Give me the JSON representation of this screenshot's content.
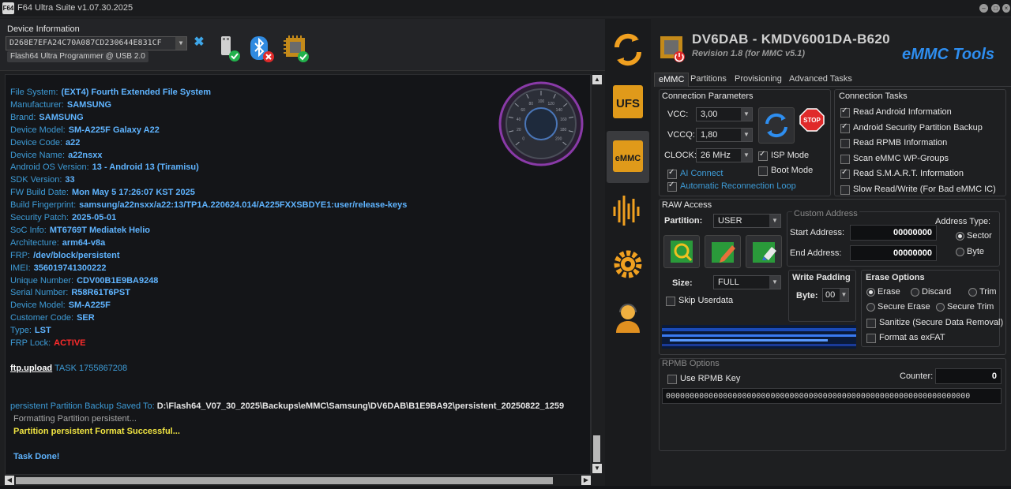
{
  "window": {
    "title": "F64 Ultra Suite v1.07.30.2025",
    "logo_text": "F64"
  },
  "device": {
    "label": "Device Information",
    "id": "D268E7EFA24C70A087CD230644E831CF",
    "port": "Flash64 Ultra Programmer @ USB 2.0",
    "icons": [
      "usb-connected-icon",
      "bluetooth-disconnected-icon",
      "chip-ok-icon"
    ]
  },
  "log": [
    {
      "k": "File System:",
      "v": "(EXT4) Fourth Extended File System"
    },
    {
      "k": "Manufacturer:",
      "v": "SAMSUNG"
    },
    {
      "k": "Brand:",
      "v": "SAMSUNG"
    },
    {
      "k": "Device Model:",
      "v": "SM-A225F  Galaxy A22"
    },
    {
      "k": "Device Code:",
      "v": "a22"
    },
    {
      "k": "Device Name:",
      "v": "a22nsxx"
    },
    {
      "k": "Android OS Version:",
      "v": "13 - Android 13 (Tiramisu)"
    },
    {
      "k": "SDK Version:",
      "v": "33"
    },
    {
      "k": "FW Build Date:",
      "v": "Mon May  5 17:26:07 KST 2025"
    },
    {
      "k": "Build Fingerprint:",
      "v": "samsung/a22nsxx/a22:13/TP1A.220624.014/A225FXXSBDYE1:user/release-keys"
    },
    {
      "k": "Security Patch:",
      "v": "2025-05-01"
    },
    {
      "k": "SoC Info:",
      "v": "MT6769T Mediatek Helio"
    },
    {
      "k": "Architecture:",
      "v": "arm64-v8a"
    },
    {
      "k": "FRP:",
      "v": "/dev/block/persistent"
    },
    {
      "k": "IMEI:",
      "v": "356019741300222"
    },
    {
      "k": "Unique Number:",
      "v": "CDV00B1E9BA9248"
    },
    {
      "k": "Serial Number:",
      "v": "R58R61T6PST"
    },
    {
      "k": "Device Model:",
      "v": "SM-A225F"
    },
    {
      "k": "Customer Code:",
      "v": "SER"
    },
    {
      "k": "Type:",
      "v": "LST"
    },
    {
      "k": "FRP Lock:",
      "v": "ACTIVE"
    }
  ],
  "log_tail": {
    "ftp_label": "ftp.upload",
    "ftp_task": "TASK 1755867208",
    "backup_label": "persistent Partition Backup Saved To:",
    "backup_path": "D:\\Flash64_V07_30_2025\\Backups\\eMMC\\Samsung\\DV6DAB\\B1E9BA92\\persistent_20250822_1259",
    "formatting": "Formatting Partition persistent...",
    "format_ok": "Partition persistent Format Successful...",
    "done": "Task Done!"
  },
  "gauge_ticks": [
    "0",
    "20",
    "40",
    "60",
    "80",
    "100",
    "120",
    "140",
    "160",
    "180",
    "200"
  ],
  "nav": [
    "refresh-icon",
    "ufs-icon",
    "emmc-icon",
    "waveform-icon",
    "settings-gear-icon",
    "support-agent-icon"
  ],
  "header": {
    "model": "DV6DAB - KMDV6001DA-B620",
    "revision": "Revision 1.8 (for MMC v5.1)",
    "tool": "eMMC Tools"
  },
  "tabs": [
    "eMMC",
    "Partitions",
    "Provisioning",
    "Advanced Tasks"
  ],
  "conn": {
    "title": "Connection Parameters",
    "vcc_label": "VCC:",
    "vcc": "3,00",
    "vccq_label": "VCCQ:",
    "vccq": "1,80",
    "clock_label": "CLOCK:",
    "clock": "26 MHz",
    "isp": "ISP Mode",
    "boot": "Boot Mode",
    "ai": "AI Connect",
    "auto": "Automatic Reconnection Loop",
    "stop": "STOP"
  },
  "tasks": {
    "title": "Connection Tasks",
    "items": [
      {
        "label": "Read Android Information",
        "on": true
      },
      {
        "label": "Android Security Partition Backup",
        "on": true
      },
      {
        "label": "Read RPMB Information",
        "on": false
      },
      {
        "label": "Scan eMMC WP-Groups",
        "on": false
      },
      {
        "label": "Read S.M.A.R.T. Information",
        "on": true
      },
      {
        "label": "Slow Read/Write (For Bad eMMC IC)",
        "on": false
      }
    ]
  },
  "raw": {
    "title": "RAW Access",
    "partition_label": "Partition:",
    "partition": "USER",
    "size_label": "Size:",
    "size": "FULL",
    "skip": "Skip Userdata"
  },
  "custom": {
    "title": "Custom Address",
    "start_label": "Start Address:",
    "start": "00000000",
    "end_label": "End Address:",
    "end": "00000000",
    "type_label": "Address Type:",
    "sector": "Sector",
    "byte": "Byte"
  },
  "padding": {
    "title": "Write Padding",
    "byte_label": "Byte:",
    "byte": "00"
  },
  "erase": {
    "title": "Erase Options",
    "erase": "Erase",
    "discard": "Discard",
    "trim": "Trim",
    "secure_erase": "Secure Erase",
    "secure_trim": "Secure Trim",
    "sanitize": "Sanitize (Secure Data Removal)",
    "format": "Format as exFAT"
  },
  "rpmb": {
    "title": "RPMB Options",
    "use_key": "Use RPMB Key",
    "counter_label": "Counter:",
    "counter": "0",
    "key": "0000000000000000000000000000000000000000000000000000000000000000"
  },
  "colors": {
    "accent": "#2e8ef0",
    "ok": "#22b14c",
    "error": "#ff2b2b",
    "warn": "#f0e442"
  }
}
